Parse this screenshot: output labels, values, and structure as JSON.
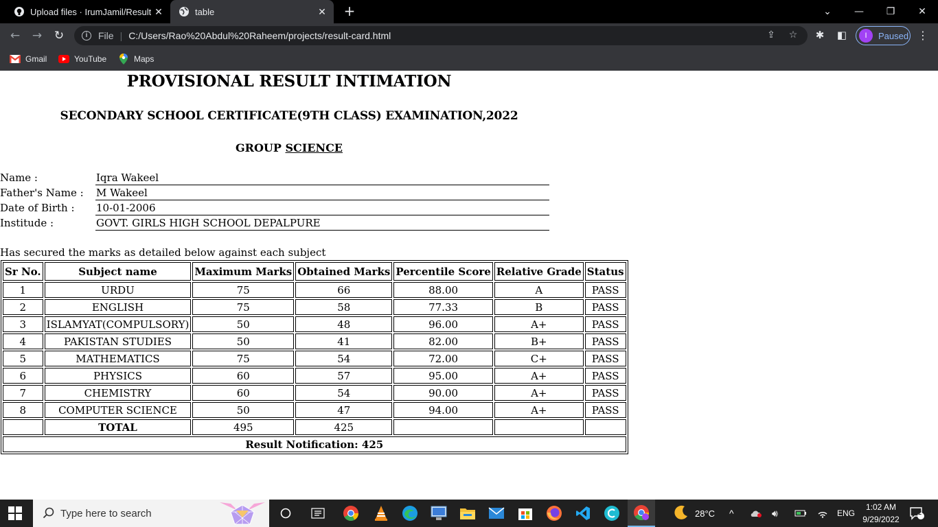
{
  "browser": {
    "tabs": [
      {
        "title": "Upload files · IrumJamil/Result_C",
        "icon": "github-icon"
      },
      {
        "title": "table",
        "icon": "globe-icon"
      }
    ],
    "scheme_label": "File",
    "url": "C:/Users/Rao%20Abdul%20Raheem/projects/result-card.html",
    "profile": {
      "initial": "I",
      "status": "Paused"
    },
    "bookmarks": [
      {
        "label": "Gmail",
        "icon": "gmail-icon"
      },
      {
        "label": "YouTube",
        "icon": "youtube-icon"
      },
      {
        "label": "Maps",
        "icon": "maps-icon"
      }
    ]
  },
  "page": {
    "title": "PROVISIONAL RESULT INTIMATION",
    "subtitle": "SECONDARY SCHOOL CERTIFICATE(9TH CLASS) EXAMINATION,2022",
    "group_label": "GROUP",
    "group_value": "SCIENCE",
    "student": {
      "name_label": "Name :",
      "name": "Iqra Wakeel",
      "father_label": "Father's Name :",
      "father": "M Wakeel",
      "dob_label": "Date of Birth :",
      "dob": "10-01-2006",
      "institute_label": "Institude :",
      "institute": "GOVT. GIRLS HIGH SCHOOL DEPALPURE"
    },
    "secured_text": "Has secured the marks as detailed below against each subject",
    "table": {
      "headers": [
        "Sr No.",
        "Subject name",
        "Maximum Marks",
        "Obtained Marks",
        "Percentile Score",
        "Relative Grade",
        "Status"
      ],
      "rows": [
        [
          "1",
          "URDU",
          "75",
          "66",
          "88.00",
          "A",
          "PASS"
        ],
        [
          "2",
          "ENGLISH",
          "75",
          "58",
          "77.33",
          "B",
          "PASS"
        ],
        [
          "3",
          "ISLAMYAT(COMPULSORY)",
          "50",
          "48",
          "96.00",
          "A+",
          "PASS"
        ],
        [
          "4",
          "PAKISTAN STUDIES",
          "50",
          "41",
          "82.00",
          "B+",
          "PASS"
        ],
        [
          "5",
          "MATHEMATICS",
          "75",
          "54",
          "72.00",
          "C+",
          "PASS"
        ],
        [
          "6",
          "PHYSICS",
          "60",
          "57",
          "95.00",
          "A+",
          "PASS"
        ],
        [
          "7",
          "CHEMISTRY",
          "60",
          "54",
          "90.00",
          "A+",
          "PASS"
        ],
        [
          "8",
          "COMPUTER SCIENCE",
          "50",
          "47",
          "94.00",
          "A+",
          "PASS"
        ]
      ],
      "total_label": "TOTAL",
      "total_max": "495",
      "total_obtained": "425",
      "notification": "Result Notification: 425"
    }
  },
  "taskbar": {
    "search_placeholder": "Type here to search",
    "temperature": "28°C",
    "language": "ENG",
    "time": "1:02 AM",
    "date": "9/29/2022",
    "notifications": "2"
  }
}
